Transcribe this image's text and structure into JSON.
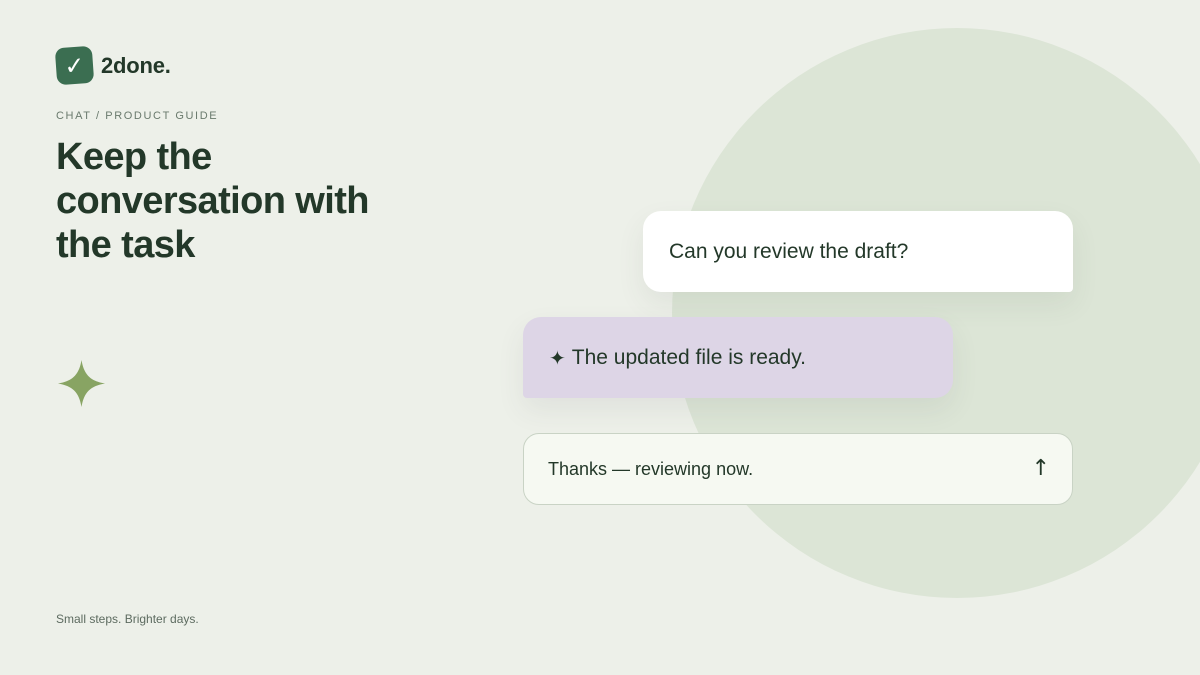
{
  "brand": {
    "name": "2done.",
    "logo_glyph": "✓",
    "logo_color": "#3b6e51"
  },
  "eyebrow": "CHAT / PRODUCT GUIDE",
  "headline": "Keep the conversation with the task",
  "tagline": "Small steps. Brighter days.",
  "decoration": {
    "sparkle_icon": "four-point-star-icon",
    "sparkle_color": "#88a463",
    "circle_color": "#dce5d6"
  },
  "chat": {
    "incoming_message": "Can you review the draft?",
    "ai_glyph": "✦",
    "ai_message": "The updated file is ready.",
    "ai_bubble_color": "#ddd5e6"
  },
  "composer": {
    "text": "Thanks — reviewing now.",
    "send_glyph": "↑"
  }
}
